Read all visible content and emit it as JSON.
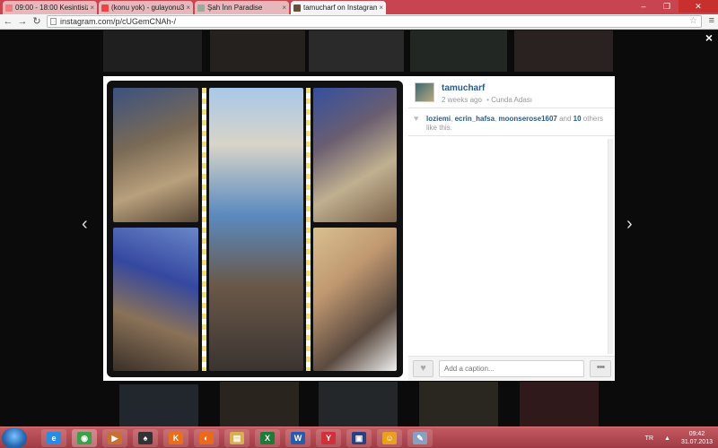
{
  "browser": {
    "tabs": [
      {
        "label": "09:00 - 18:00 Kesintisiz Mi...",
        "fav": "#ef7f7f",
        "active": false
      },
      {
        "label": "(konu yok) - gulayonu30...",
        "fav": "#e44",
        "active": false
      },
      {
        "label": "Şah İnn Paradise",
        "fav": "#9a9",
        "active": false
      },
      {
        "label": "tamucharf on Instagram",
        "fav": "#6b4f3b",
        "active": true
      }
    ],
    "tab_close": "×",
    "url": "instagram.com/p/cUGemCNAh-/",
    "window_controls": {
      "minimize": "–",
      "maximize": "❐",
      "close": "✕"
    },
    "nav": {
      "back": "←",
      "forward": "→",
      "reload": "↻"
    },
    "star_glyph": "☆",
    "menu_glyph": "≡"
  },
  "lightbox": {
    "close_glyph": "×",
    "prev_glyph": "‹",
    "next_glyph": "›",
    "post": {
      "username": "tamucharf",
      "time": "2 weeks ago",
      "location": "Cunda Adası",
      "likes": {
        "users": [
          "loziemi",
          "ecrin_hafsa",
          "moonserose1607"
        ],
        "sep": ", ",
        "and_text": " and ",
        "others_count": "10",
        "others_text": " others like this."
      },
      "caption_placeholder": "Add a caption...",
      "more_glyph": "•••",
      "heart_glyph": "♥"
    }
  },
  "taskbar": {
    "apps": [
      {
        "name": "ie",
        "glyph": "e",
        "color": "#2a8be0"
      },
      {
        "name": "chrome",
        "glyph": "◉",
        "color": "#3aa04a"
      },
      {
        "name": "media",
        "glyph": "▶",
        "color": "#c87030"
      },
      {
        "name": "game",
        "glyph": "♠",
        "color": "#333"
      },
      {
        "name": "k",
        "glyph": "K",
        "color": "#e8701a"
      },
      {
        "name": "firefox",
        "glyph": "◐",
        "color": "#e86a1a"
      },
      {
        "name": "explorer",
        "glyph": "▤",
        "color": "#d8b050"
      },
      {
        "name": "excel",
        "glyph": "X",
        "color": "#1f7a3a"
      },
      {
        "name": "word",
        "glyph": "W",
        "color": "#2b5aa8"
      },
      {
        "name": "yandex",
        "glyph": "Y",
        "color": "#d0303a"
      },
      {
        "name": "ulead",
        "glyph": "▣",
        "color": "#2a3f80"
      },
      {
        "name": "messenger",
        "glyph": "☺",
        "color": "#e8a020"
      },
      {
        "name": "paint",
        "glyph": "✎",
        "color": "#8aa0c0"
      }
    ],
    "lang": "TR",
    "tray_arrow": "▲",
    "time": "09:42",
    "date": "31.07.2013"
  }
}
